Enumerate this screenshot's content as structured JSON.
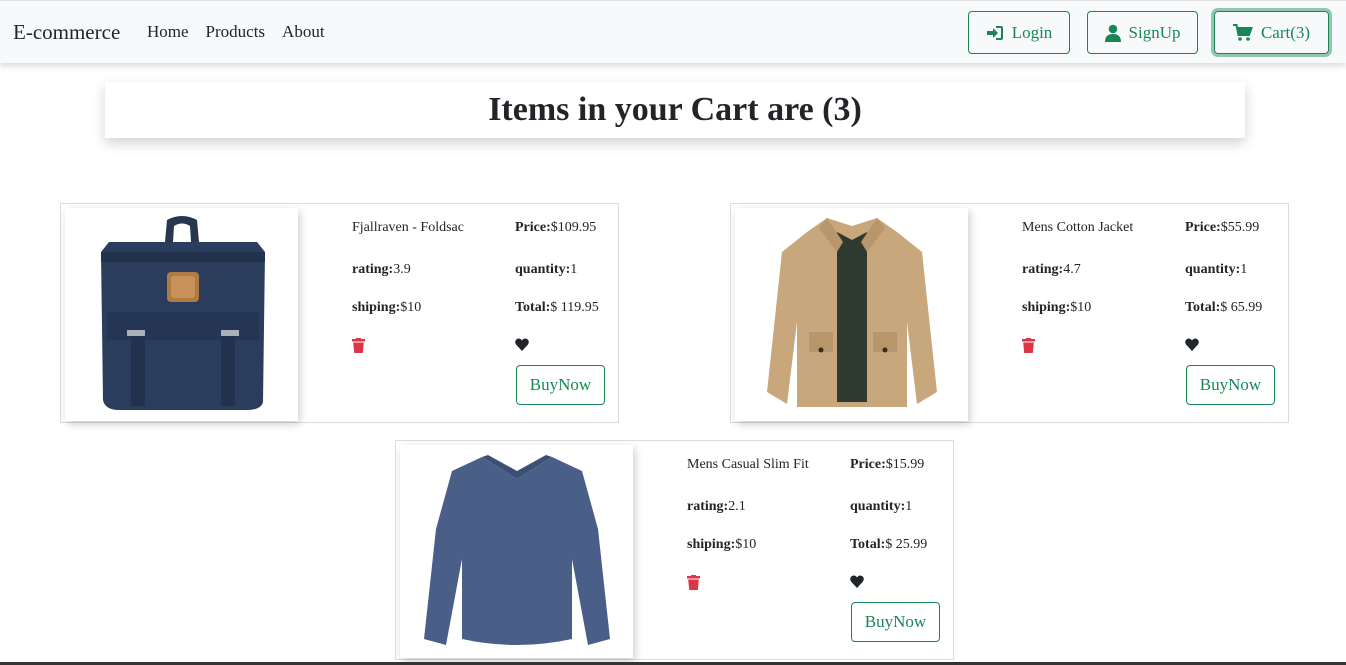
{
  "navbar": {
    "brand": "E-commerce",
    "links": [
      "Home",
      "Products",
      "About"
    ],
    "login_label": "Login",
    "signup_label": "SignUp",
    "cart_label": "Cart(3)",
    "accent_color": "#198754"
  },
  "header": {
    "title": "Items in your Cart are (3)"
  },
  "cart_items": [
    {
      "name": "Fjallraven - Foldsac",
      "price_label": "Price:",
      "price": "$109.95",
      "rating_label": "rating:",
      "rating": "3.9",
      "quantity_label": "quantity:",
      "quantity": "1",
      "shipping_label": "shiping:",
      "shipping": "$10",
      "total_label": "Total:",
      "total": "$ 119.95",
      "buy_label": "BuyNow",
      "image_icon": "backpack-icon"
    },
    {
      "name": "Mens Cotton Jacket",
      "price_label": "Price:",
      "price": "$55.99",
      "rating_label": "rating:",
      "rating": "4.7",
      "quantity_label": "quantity:",
      "quantity": "1",
      "shipping_label": "shiping:",
      "shipping": "$10",
      "total_label": "Total:",
      "total": "$ 65.99",
      "buy_label": "BuyNow",
      "image_icon": "jacket-icon"
    },
    {
      "name": "Mens Casual Slim Fit",
      "price_label": "Price:",
      "price": "$15.99",
      "rating_label": "rating:",
      "rating": "2.1",
      "quantity_label": "quantity:",
      "quantity": "1",
      "shipping_label": "shiping:",
      "shipping": "$10",
      "total_label": "Total:",
      "total": "$ 25.99",
      "buy_label": "BuyNow",
      "image_icon": "tshirt-icon"
    }
  ],
  "colors": {
    "delete": "#dc3545",
    "heart": "#212529"
  }
}
